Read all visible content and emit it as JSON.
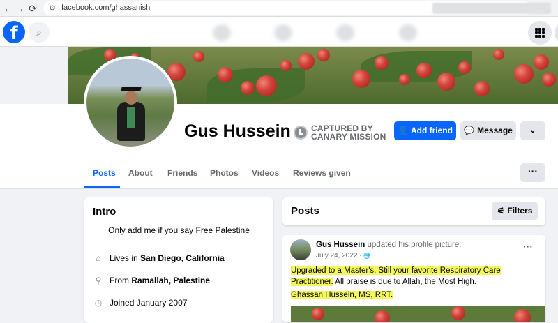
{
  "browser": {
    "url": "facebook.com/ghassanish",
    "back_icon": "←",
    "forward_icon": "→",
    "reload_icon": "⟳"
  },
  "fb_bar": {
    "logo": "f",
    "search_icon": "⌕"
  },
  "profile": {
    "name": "Gus Hussein",
    "canary_line1": "CAPTURED BY",
    "canary_line2": "CANARY MISSION",
    "add_friend": "Add friend",
    "message": "Message",
    "more_icon": "⌄"
  },
  "tabs": [
    {
      "label": "Posts"
    },
    {
      "label": "About"
    },
    {
      "label": "Friends"
    },
    {
      "label": "Photos"
    },
    {
      "label": "Videos"
    },
    {
      "label": "Reviews given"
    }
  ],
  "tabs_more": "···",
  "intro": {
    "title": "Intro",
    "bio": "Only add me if you say Free Palestine",
    "lives_prefix": "Lives in ",
    "lives_value": "San Diego, California",
    "from_prefix": "From ",
    "from_value": "Ramallah, Palestine",
    "joined": "Joined January 2007"
  },
  "posts": {
    "title": "Posts",
    "filters": "Filters"
  },
  "post": {
    "author": "Gus Hussein",
    "action": " updated his profile picture.",
    "date": "July 24, 2022 · ",
    "privacy_icon": "🌐",
    "text_hl1": "Upgraded to a Master's. Still your favorite Respiratory Care",
    "text_hl2": "Practitioner.",
    "text_rest": " All praise is due to Allah, the Most High.",
    "signature": "Ghassan Hussein, MS, RRT.",
    "menu_icon": "···"
  },
  "colors": {
    "brand": "#0866ff",
    "highlight": "#f4f85a"
  }
}
